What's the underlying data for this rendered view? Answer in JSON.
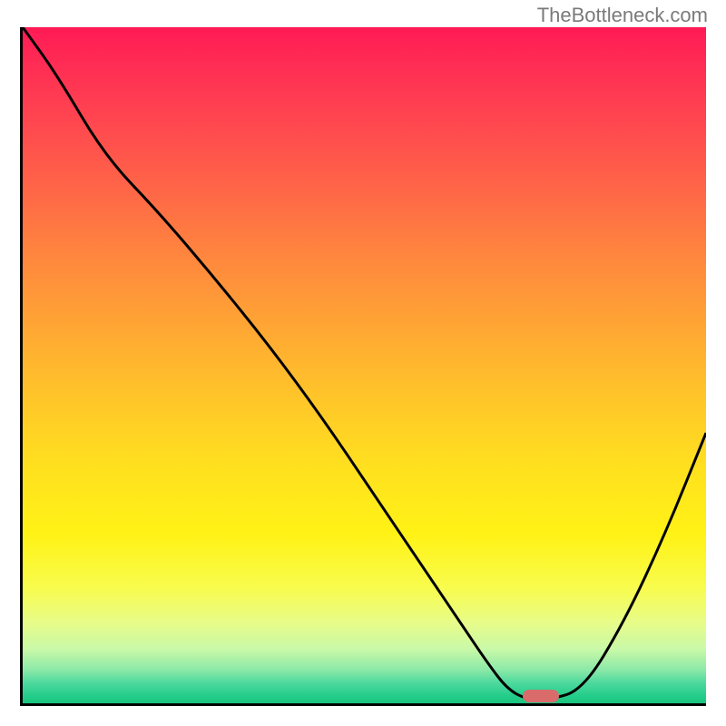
{
  "watermark": "TheBottleneck.com",
  "chart_data": {
    "type": "line",
    "title": "",
    "xlabel": "",
    "ylabel": "",
    "xlim": [
      0,
      100
    ],
    "ylim": [
      0,
      100
    ],
    "grid": false,
    "series": [
      {
        "name": "curve",
        "x": [
          0,
          5,
          12,
          20,
          28,
          36,
          44,
          52,
          58,
          64,
          68,
          71,
          74,
          77,
          82,
          88,
          94,
          100
        ],
        "y": [
          100,
          93,
          81,
          72.5,
          63,
          53,
          42,
          30,
          21,
          12,
          6,
          2,
          0.5,
          0.5,
          2,
          12,
          25,
          40
        ]
      }
    ],
    "marker": {
      "x": 75.5,
      "y": 1.5
    },
    "colors": {
      "curve": "#000000",
      "marker": "#d96b6b"
    }
  }
}
